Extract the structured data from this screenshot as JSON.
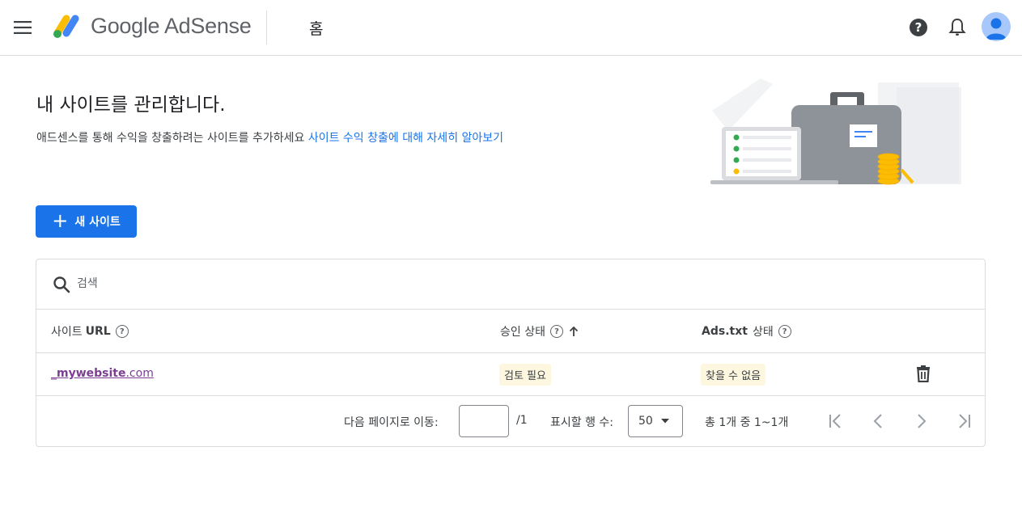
{
  "header": {
    "brand": "Google AdSense",
    "page": "홈",
    "icons": [
      "menu-icon",
      "help-icon",
      "notifications-icon",
      "account-avatar"
    ]
  },
  "hero": {
    "title": "내 사이트를 관리합니다.",
    "description": "애드센스를 통해 수익을 창출하려는 사이트를 추가하세요",
    "learn_more": "사이트 수익 창출에 대해 자세히 알아보기"
  },
  "new_site_button": {
    "icon": "+",
    "label": "새 사이트"
  },
  "table": {
    "search_placeholder": "검색",
    "columns": {
      "url_prefix": "사이트",
      "url_bold": "URL",
      "approval": "승인 상태",
      "ads_txt_bold": "Ads.txt",
      "ads_txt_suffix": "상태"
    },
    "rows": [
      {
        "site_prefix": "_",
        "site_name": "mywebsite",
        "site_tld": ".com",
        "approval_status": "검토 필요",
        "ads_txt_status": "찾을 수 없음"
      }
    ],
    "pager": {
      "goto_label": "다음 페이지로 이동:",
      "page_value": "",
      "page_total": "/1",
      "rows_label": "표시할 행 수:",
      "rows_value": "50",
      "range_text": "총 1개 중 1~1개"
    }
  },
  "colors": {
    "accent": "#1a73e8",
    "link_visited": "#7b3e92",
    "chip_bg": "#fef7e0"
  }
}
